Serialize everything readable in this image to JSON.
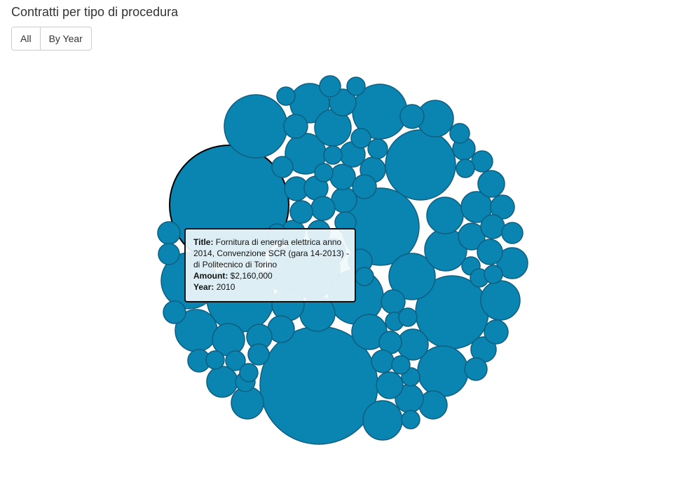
{
  "header": {
    "title": "Contratti per tipo di procedura"
  },
  "view_toggle": {
    "all_label": "All",
    "by_year_label": "By Year"
  },
  "tooltip": {
    "title_label": "Title:",
    "title_value": "Fornitura di energia elettrica anno 2014, Convenzione SCR (gara 14-2013) - di Politecnico di Torino",
    "amount_label": "Amount:",
    "amount_value": "$2,160,000",
    "year_label": "Year:",
    "year_value": "2010"
  },
  "colors": {
    "bubble_fill": "#0a84b0",
    "bubble_stroke": "#0e5f80",
    "selected_stroke": "#000000"
  },
  "chart_data": {
    "type": "bubble-pack",
    "title": "Contratti per tipo di procedura",
    "bubble_count": 104,
    "largest_visible_amount": "$2,160,000",
    "selected_bubble": {
      "title": "Fornitura di energia elettrica anno 2014, Convenzione SCR (gara 14-2013) - di Politecnico di Torino",
      "amount": 2160000,
      "year": 2010
    }
  }
}
